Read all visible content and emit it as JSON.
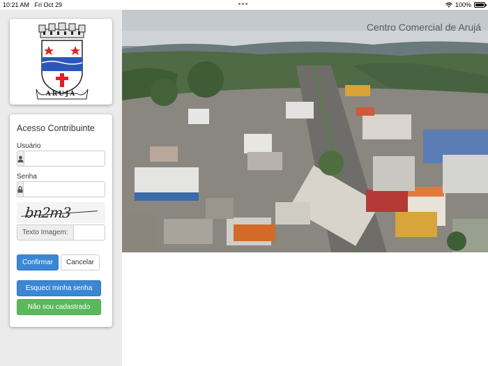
{
  "status_bar": {
    "time": "10:21 AM",
    "date": "Fri Oct 29",
    "battery": "100%"
  },
  "logo": {
    "city_name": "ARUJÁ"
  },
  "login": {
    "title": "Acesso Contribuinte",
    "username_label": "Usuário",
    "username_value": "",
    "password_label": "Senha",
    "password_value": "",
    "captcha_code": "bn2m3",
    "captcha_label": "Texto Imagem:",
    "captcha_value": "",
    "confirm_button": "Confirmar",
    "cancel_button": "Cancelar",
    "forgot_password_button": "Esqueci minha senha",
    "not_registered_button": "Não sou cadastrado"
  },
  "hero": {
    "caption": "Centro Comercial de Arujá"
  },
  "colors": {
    "primary": "#3a87d4",
    "success": "#5bb85c",
    "sidebar_bg": "#ebebeb"
  },
  "icons": {
    "user": "user-icon",
    "lock": "lock-icon",
    "wifi": "wifi-icon",
    "battery": "battery-icon"
  }
}
